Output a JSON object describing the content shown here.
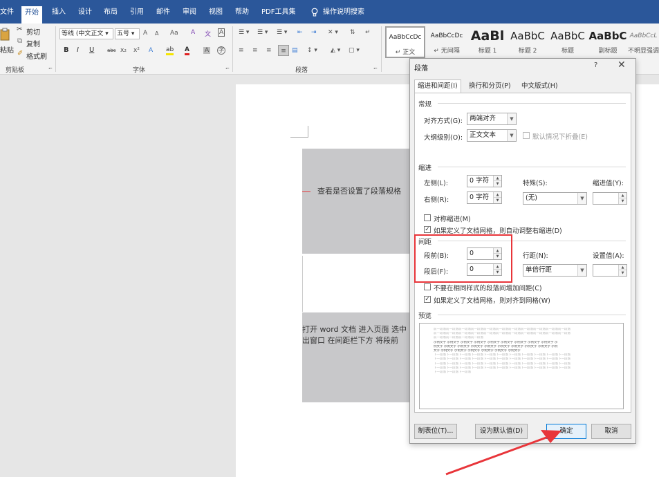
{
  "menu": {
    "tabs": [
      "文件",
      "开始",
      "插入",
      "设计",
      "布局",
      "引用",
      "邮件",
      "审阅",
      "视图",
      "帮助",
      "PDF工具集"
    ],
    "search": "操作说明搜索"
  },
  "ribbon": {
    "clipboard": {
      "cut": "剪切",
      "copy": "复制",
      "format_painter": "格式刷",
      "paste": "粘贴",
      "label": "剪贴板"
    },
    "font": {
      "font_name": "等线 (中文正文",
      "font_size": "五号",
      "grow": "A",
      "shrink": "A",
      "case": "Aa",
      "bold": "B",
      "italic": "I",
      "underline": "U",
      "strike": "abc",
      "sub": "x₂",
      "sup": "x²",
      "label": "字体"
    },
    "paragraph": {
      "label": "段落"
    },
    "styles": [
      {
        "sample": "AaBbCcDc",
        "name": "↵ 正文"
      },
      {
        "sample": "AaBbCcDc",
        "name": "↵ 无间隔"
      },
      {
        "sample": "AaBl",
        "name": "标题 1"
      },
      {
        "sample": "AaBbC",
        "name": "标题 2"
      },
      {
        "sample": "AaBbC",
        "name": "标题"
      },
      {
        "sample": "AaBbC",
        "name": "副标题"
      },
      {
        "sample": "AaBbCcL",
        "name": "不明显强调"
      }
    ]
  },
  "document": {
    "line1": "查看是否设置了段落规格",
    "line2a": "打开 word 文档  进入页面  选中",
    "line2b": "出窗口  在间距栏下方  将段前"
  },
  "dialog": {
    "title": "段落",
    "help": "?",
    "close": "✕",
    "tabs": [
      "缩进和间距(I)",
      "换行和分页(P)",
      "中文版式(H)"
    ],
    "general": {
      "section": "常规",
      "alignment_label": "对齐方式(G):",
      "alignment_value": "两端对齐",
      "outline_label": "大纲级别(O):",
      "outline_value": "正文文本",
      "collapse_label": "默认情况下折叠(E)"
    },
    "indent": {
      "section": "缩进",
      "left_label": "左侧(L):",
      "left_value": "0 字符",
      "right_label": "右侧(R):",
      "right_value": "0 字符",
      "special_label": "特殊(S):",
      "special_value": "(无)",
      "indent_by_label": "缩进值(Y):",
      "indent_by_value": "",
      "mirror_label": "对称缩进(M)",
      "auto_adjust_label": "如果定义了文档网格，则自动调整右缩进(D)"
    },
    "spacing": {
      "section": "间距",
      "before_label": "段前(B):",
      "before_value": "0",
      "after_label": "段后(F):",
      "after_value": "0",
      "line_label": "行距(N):",
      "line_value": "单倍行距",
      "at_label": "设置值(A):",
      "at_value": "",
      "no_space_label": "不要在相同样式的段落间增加间距(C)",
      "snap_grid_label": "如果定义了文档网格，则对齐到网格(W)"
    },
    "preview": {
      "section": "预览",
      "lines_before": [
        "前一段落前一段落前一段落前一段落前一段落前一段落前一段落前一段落前一段落前一段落前一段落",
        "前一段落前一段落前一段落前一段落前一段落前一段落前一段落前一段落前一段落前一段落前一段落",
        "前一段落前一段落前一段落前一段落"
      ],
      "lines_sample": [
        "示例文字 示例文字 示例文字 示例文字 示例文字 示例文字 示例文字 示例文字 示例文字 示",
        "例文字 示例文字 示例文字 示例文字 示例文字 示例文字 示例文字 示例文字 示例文字 示例",
        "文字 示例文字 示例文字 示例文字 示例文字 示例文字 示例文字"
      ],
      "lines_after": [
        "下一段落下一段落下一段落下一段落下一段落下一段落下一段落下一段落下一段落下一段落下一段落",
        "下一段落下一段落下一段落下一段落下一段落下一段落下一段落下一段落下一段落下一段落下一段落",
        "下一段落下一段落下一段落下一段落下一段落下一段落下一段落下一段落下一段落下一段落下一段落",
        "下一段落下一段落下一段落下一段落下一段落下一段落下一段落下一段落下一段落下一段落下一段落",
        "下一段落下一段落下一段落"
      ]
    },
    "buttons": {
      "tabs": "制表位(T)...",
      "set_default": "设为默认值(D)",
      "ok": "确定",
      "cancel": "取消"
    }
  },
  "colors": {
    "ribbon_blue": "#2b579a",
    "highlight_red": "#e8353a",
    "ok_border": "#0078d7"
  }
}
